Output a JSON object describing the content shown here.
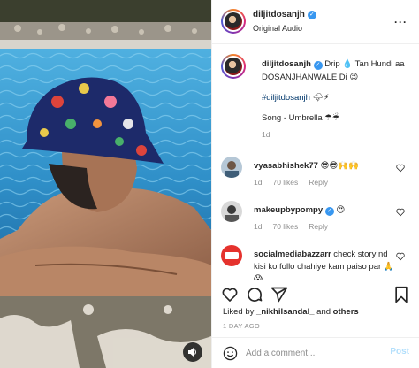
{
  "post": {
    "username": "diljitdosanjh",
    "audio": "Original Audio",
    "more_icon": "more-horizontal-icon"
  },
  "caption": {
    "username": "diljitdosanjh",
    "text_part1": "Drip",
    "text_part2": "Tan Hundi aa DOSANJHANWALE Di",
    "hashtag": "#diljitdosanjh",
    "song": "Song - Umbrella",
    "time": "1d"
  },
  "comments": [
    {
      "username": "vyasabhishek77",
      "text": "",
      "emojis": "😎😎🙌🙌",
      "time": "1d",
      "likes": "70 likes",
      "reply": "Reply"
    },
    {
      "username": "makeupbypompy",
      "text": "",
      "emojis": "😍",
      "time": "1d",
      "likes": "70 likes",
      "reply": "Reply"
    },
    {
      "username": "socialmediabazzarr",
      "text": "check story nd kisi ko follo chahiye kam paiso par",
      "emojis": "🙏😱",
      "time": "",
      "likes": "",
      "reply": ""
    }
  ],
  "actions": {
    "liked_prefix": "Liked by",
    "liked_user": "_nikhilsandal_",
    "liked_and": "and",
    "liked_others": "others",
    "date": "1 DAY AGO"
  },
  "add_comment": {
    "placeholder": "Add a comment...",
    "post_label": "Post"
  },
  "colors": {
    "verified": "#3897f0",
    "link": "#00376b",
    "muted": "#8e8e8e",
    "post_disabled": "#b2dffc",
    "pool": "#3a9ad0"
  }
}
